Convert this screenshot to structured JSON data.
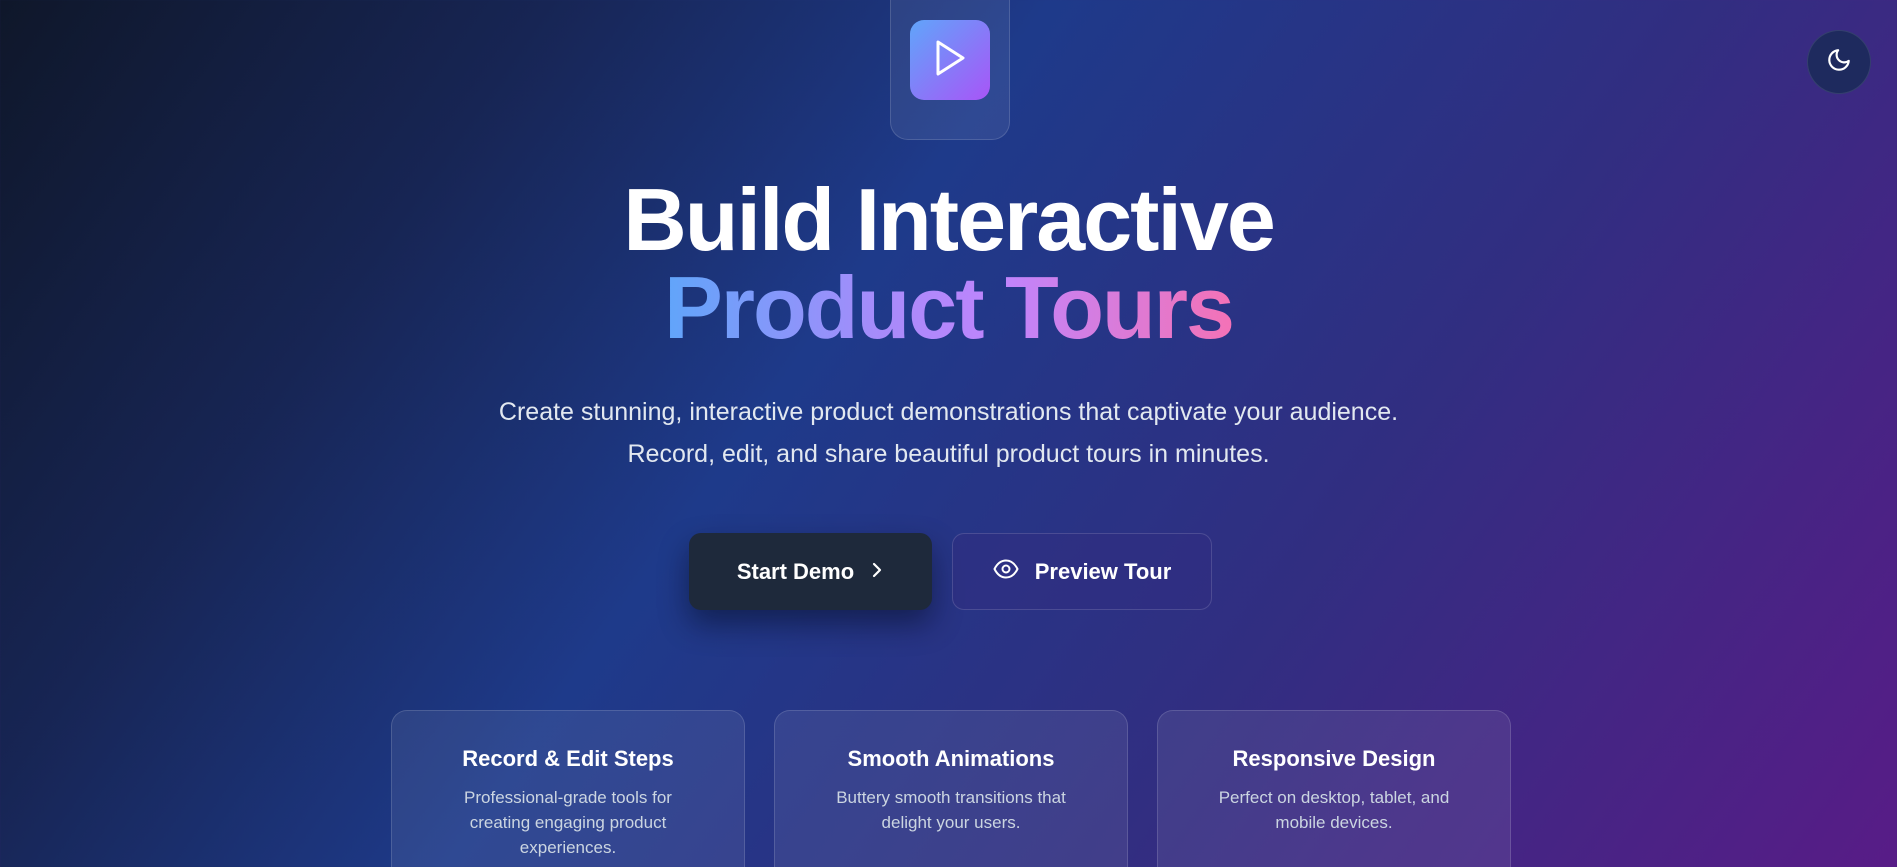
{
  "hero": {
    "headline_line1": "Build Interactive",
    "headline_line2": "Product Tours",
    "subtitle": "Create stunning, interactive product demonstrations that captivate your audience. Record, edit, and share beautiful product tours in minutes."
  },
  "actions": {
    "primary_label": "Start Demo",
    "secondary_label": "Preview Tour"
  },
  "features": [
    {
      "title": "Record & Edit Steps",
      "description": "Professional-grade tools for creating engaging product experiences."
    },
    {
      "title": "Smooth Animations",
      "description": "Buttery smooth transitions that delight your users."
    },
    {
      "title": "Responsive Design",
      "description": "Perfect on desktop, tablet, and mobile devices."
    }
  ],
  "icons": {
    "logo": "play-icon",
    "theme_toggle": "moon-icon",
    "primary_button": "chevron-right-icon",
    "secondary_button": "eye-icon"
  },
  "colors": {
    "gradient_text_start": "#60a5fa",
    "gradient_text_end": "#f472b6",
    "logo_gradient_start": "#60a5fa",
    "logo_gradient_end": "#a855f7",
    "primary_button_bg": "#1e293b"
  }
}
